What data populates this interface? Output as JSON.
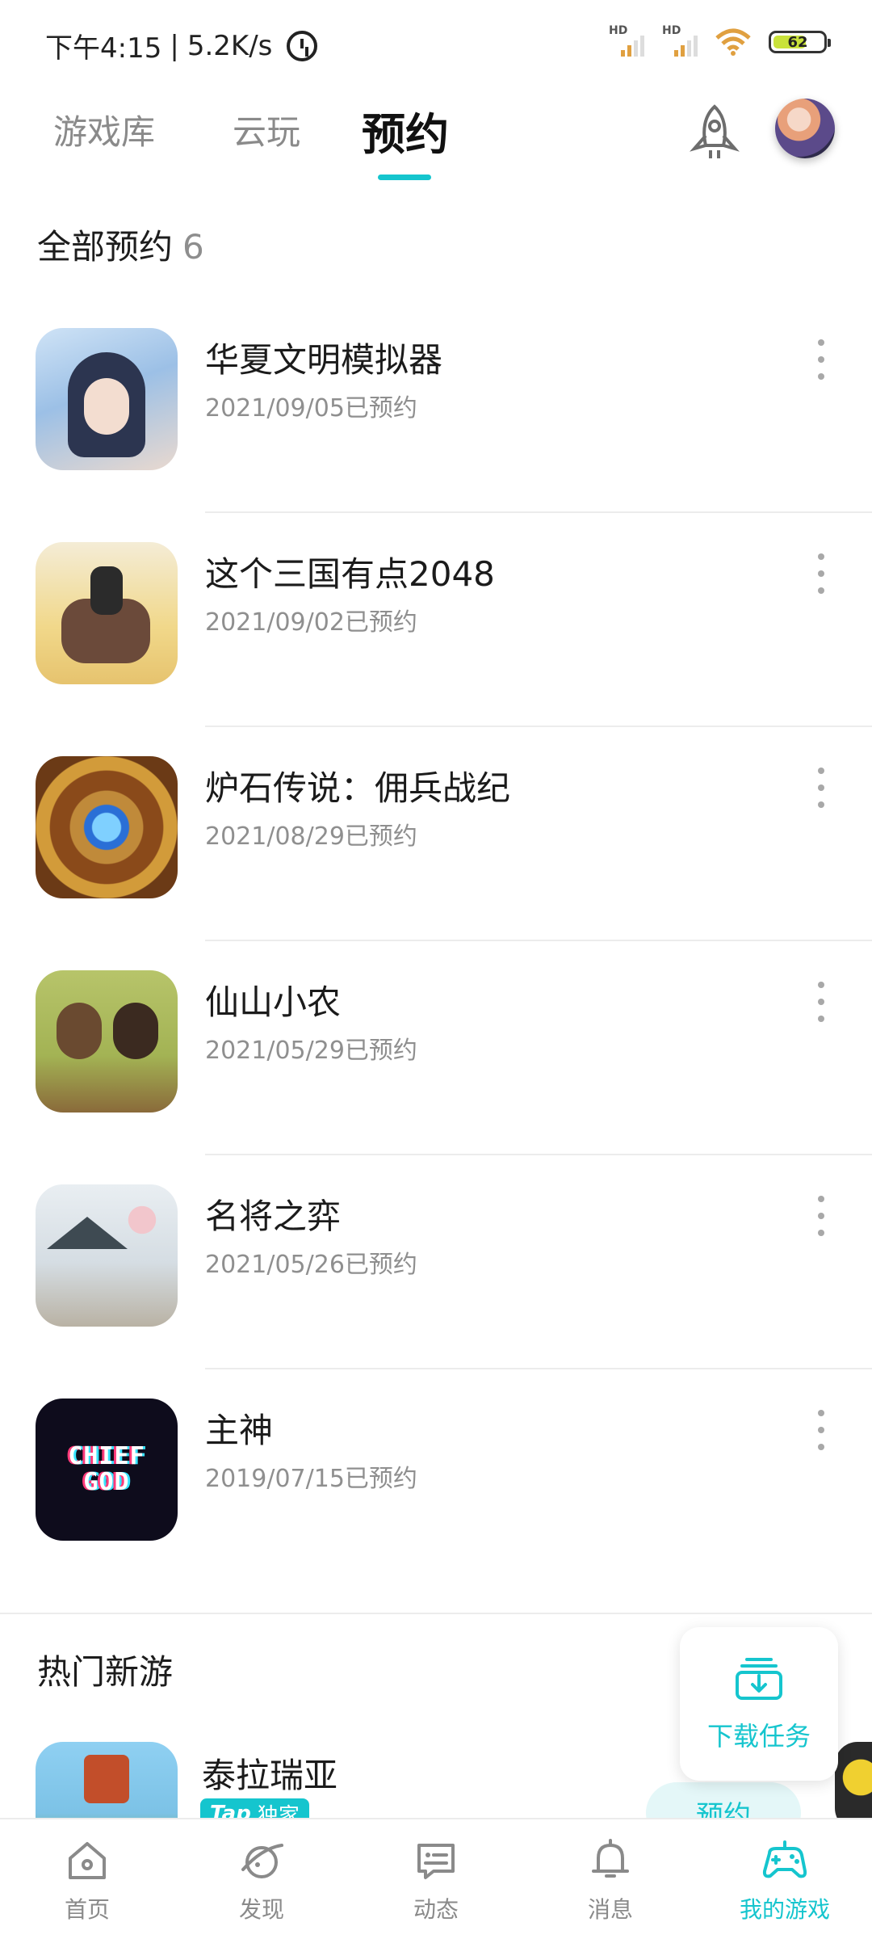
{
  "status_bar": {
    "time": "下午4:15",
    "separator": "|",
    "network_speed": "5.2K/s",
    "sim1_label": "HD",
    "sim2_label": "HD",
    "battery_level": "62",
    "icons": [
      "alarm-icon",
      "signal-icon",
      "wifi-icon",
      "battery-icon"
    ]
  },
  "top_tabs": {
    "items": [
      {
        "label": "游戏库"
      },
      {
        "label": "云玩"
      },
      {
        "label": "预约"
      }
    ],
    "active": "预约"
  },
  "reservations": {
    "title": "全部预约",
    "count": "6",
    "games": [
      {
        "name": "华夏文明模拟器",
        "date": "2021/09/05已预约"
      },
      {
        "name": "这个三国有点2048",
        "date": "2021/09/02已预约"
      },
      {
        "name": "炉石传说：佣兵战纪",
        "date": "2021/08/29已预约"
      },
      {
        "name": "仙山小农",
        "date": "2021/05/29已预约"
      },
      {
        "name": "名将之弈",
        "date": "2021/05/26已预约"
      },
      {
        "name": "主神",
        "date": "2019/07/15已预约"
      }
    ]
  },
  "hot_new": {
    "title": "热门新游",
    "game": {
      "name": "泰拉瑞亚",
      "badge_tap": "Tap",
      "badge_text": "独家",
      "button_label": "预约"
    }
  },
  "download_card": {
    "label": "下载任务"
  },
  "bottom_nav": {
    "items": [
      {
        "label": "首页",
        "icon": "home-icon"
      },
      {
        "label": "发现",
        "icon": "discover-icon"
      },
      {
        "label": "动态",
        "icon": "feed-icon"
      },
      {
        "label": "消息",
        "icon": "bell-icon"
      },
      {
        "label": "我的游戏",
        "icon": "gamepad-icon"
      }
    ],
    "active": "我的游戏"
  },
  "colors": {
    "accent": "#15c5ce",
    "text_primary": "#1b1b1b",
    "text_secondary": "#8f8f8f",
    "divider": "#ececec"
  }
}
